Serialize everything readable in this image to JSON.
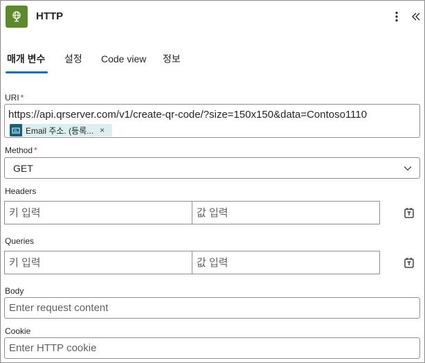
{
  "header": {
    "title": "HTTP",
    "app_icon": "globe-icon",
    "app_icon_color": "#5a8a2c",
    "more_icon": "more-vertical-icon",
    "collapse_icon": "double-chevron-left-icon"
  },
  "tabs": [
    {
      "label": "매개 변수",
      "active": true
    },
    {
      "label": "설정",
      "active": false
    },
    {
      "label": "Code view",
      "active": false
    },
    {
      "label": "정보",
      "active": false
    }
  ],
  "accent_color": "#0f6cbd",
  "uri": {
    "label": "URI",
    "required_mark": "*",
    "value": "https://api.qrserver.com/v1/create-qr-code/?size=150x150&data=Contoso1110",
    "token": {
      "label": "Email 주소. (등록...",
      "icon": "dynamic-content-icon",
      "remove": "×"
    }
  },
  "method": {
    "label": "Method",
    "required_mark": "*",
    "value": "GET",
    "icon": "chevron-down-icon"
  },
  "headers": {
    "label": "Headers",
    "key_placeholder": "키 입력",
    "value_placeholder": "값 입력",
    "icon": "switch-to-text-mode-icon"
  },
  "queries": {
    "label": "Queries",
    "key_placeholder": "키 입력",
    "value_placeholder": "값 입력",
    "icon": "switch-to-text-mode-icon"
  },
  "body": {
    "label": "Body",
    "placeholder": "Enter request content"
  },
  "cookie": {
    "label": "Cookie",
    "placeholder": "Enter HTTP cookie"
  }
}
